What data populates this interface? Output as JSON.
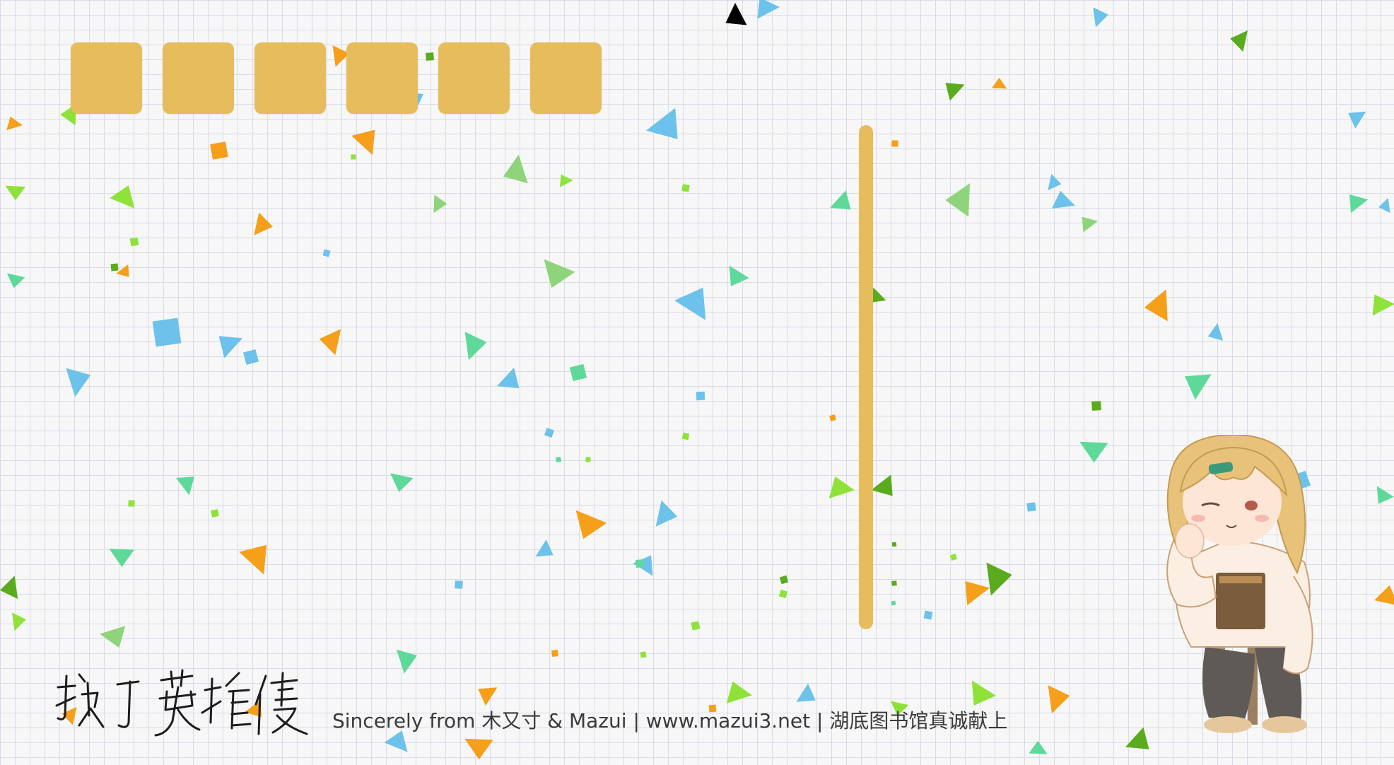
{
  "game": {
    "slot_count": 6,
    "slots": [
      "",
      "",
      "",
      "",
      "",
      ""
    ]
  },
  "logo": {
    "text": "挨打英雄传"
  },
  "footer": {
    "credit": "Sincerely from 木又寸 & Mazui ",
    "sep1": "|",
    "url": "www.mazui3.net",
    "sep2": "|",
    "tagline": "湖底图书馆真诚献上"
  },
  "colors": {
    "slot": "#e6bc5c",
    "divider": "#e6bc5c",
    "grid": "#d9dbe8",
    "background": "#f7f7f7",
    "confetti": [
      "#f59f1a",
      "#6cc2ea",
      "#5ed99a",
      "#8ee23a",
      "#5aab1e",
      "#8fd47a"
    ]
  },
  "icons": [
    "confetti-background",
    "chibi-girl-mascot",
    "handwritten-logo"
  ]
}
